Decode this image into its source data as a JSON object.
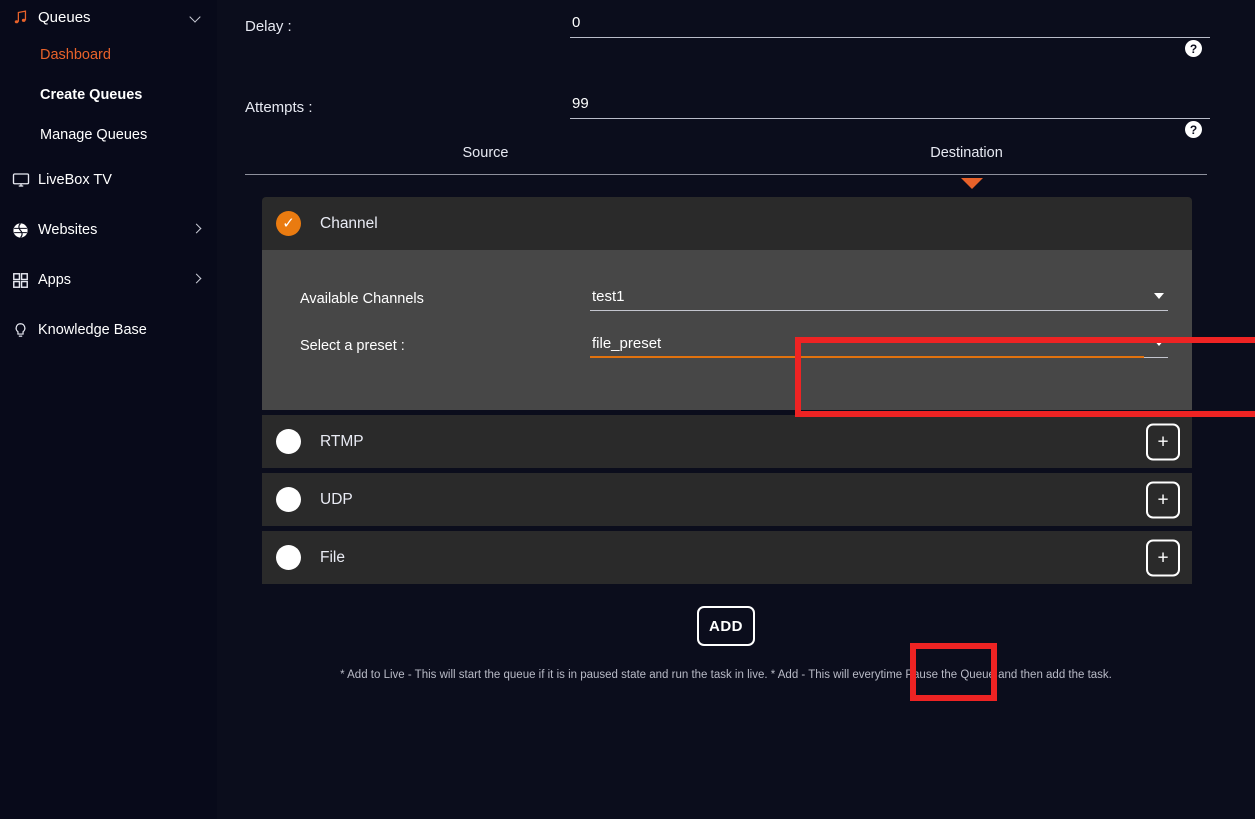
{
  "sidebar": {
    "groups": [
      {
        "label": "Queues",
        "icon": "music-note-icon",
        "chevron": "chevron-down-icon",
        "expanded": true,
        "children": [
          {
            "label": "Dashboard",
            "state": "active"
          },
          {
            "label": "Create Queues",
            "state": "bold"
          },
          {
            "label": "Manage Queues",
            "state": "normal"
          }
        ]
      }
    ],
    "items": [
      {
        "label": "LiveBox TV",
        "icon": "monitor-icon",
        "chevron": ""
      },
      {
        "label": "Websites",
        "icon": "globe-icon",
        "chevron": "chevron-right-icon"
      },
      {
        "label": "Apps",
        "icon": "grid-icon",
        "chevron": "chevron-right-icon"
      },
      {
        "label": "Knowledge Base",
        "icon": "lightbulb-icon",
        "chevron": ""
      }
    ]
  },
  "form": {
    "delay": {
      "label": "Delay :",
      "value": "0",
      "help": "?"
    },
    "attempts": {
      "label": "Attempts :",
      "value": "99",
      "help": "?"
    }
  },
  "tabs": {
    "items": [
      {
        "label": "Source",
        "selected": false
      },
      {
        "label": "Destination",
        "selected": true
      }
    ]
  },
  "destination": {
    "channel": {
      "label": "Channel",
      "selected": true,
      "check_glyph": "✓",
      "add_label": "+",
      "fields": [
        {
          "label": "Available Channels",
          "value": "test1",
          "underline": "gray"
        },
        {
          "label": "Select a preset :",
          "value": "file_preset",
          "underline": "orange"
        }
      ]
    },
    "options": [
      {
        "label": "RTMP",
        "selected": false,
        "add_label": "+"
      },
      {
        "label": "UDP",
        "selected": false,
        "add_label": "+"
      },
      {
        "label": "File",
        "selected": false,
        "add_label": "+"
      }
    ]
  },
  "actions": {
    "add_label": "ADD",
    "footnote": "* Add to Live - This will start the queue if it is in paused state and run the task in live. * Add - This will everytime Pause the Queue and then add the task."
  },
  "colors": {
    "accent_orange": "#e8622a",
    "highlight_red": "#ee2323",
    "background": "#080a1a",
    "card": "#2a2a2a",
    "card_body": "#474747"
  }
}
